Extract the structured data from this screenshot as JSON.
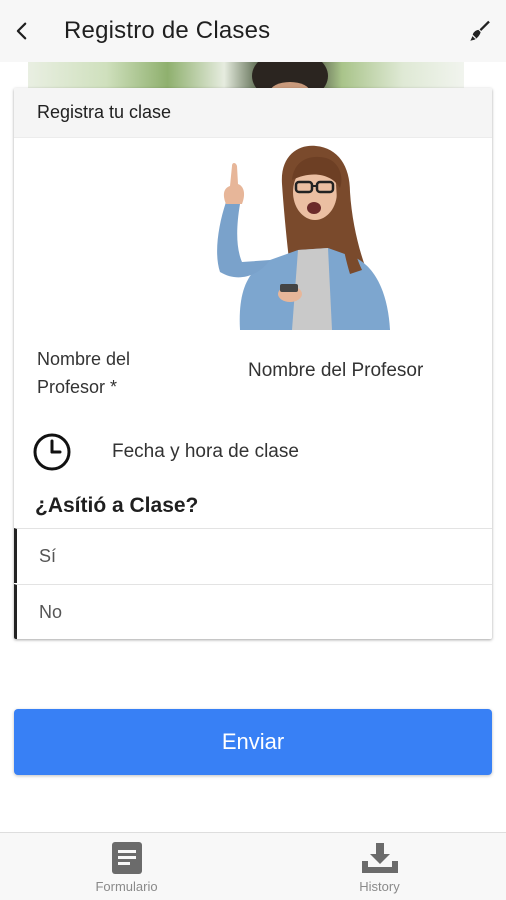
{
  "appbar": {
    "title": "Registro de Clases",
    "back_icon": "chevron-left-icon",
    "action_icon": "brush-icon"
  },
  "card": {
    "header": "Registra tu clase",
    "photo": "woman-pointing-up-photo",
    "teacher_field": {
      "label": "Nombre del Profesor *",
      "placeholder": "Nombre del Profesor"
    },
    "date_field": {
      "icon": "clock-icon",
      "placeholder": "Fecha y hora de clase"
    },
    "question": "¿Asítió a Clase?",
    "options": [
      "Sí",
      "No"
    ]
  },
  "submit": {
    "label": "Enviar",
    "color": "#3880f5"
  },
  "bottom_nav": {
    "items": [
      {
        "label": "Formulario",
        "icon": "document-icon"
      },
      {
        "label": "History",
        "icon": "download-tray-icon"
      }
    ]
  }
}
